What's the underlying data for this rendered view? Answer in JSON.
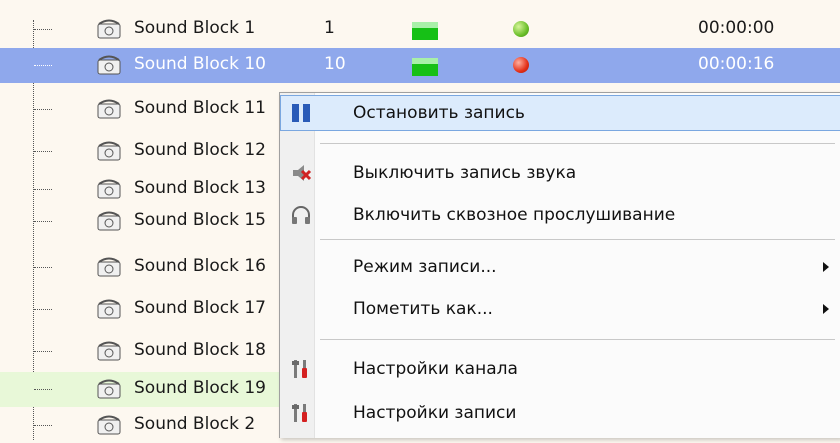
{
  "rows": [
    {
      "name": "Sound Block 1",
      "num": "1",
      "time": "00:00:00",
      "status": "green"
    },
    {
      "name": "Sound Block 10",
      "num": "10",
      "time": "00:00:16",
      "status": "red"
    },
    {
      "name": "Sound Block 11",
      "num": "",
      "time": "",
      "status": ""
    },
    {
      "name": "Sound Block 12",
      "num": "",
      "time": "",
      "status": ""
    },
    {
      "name": "Sound Block 13",
      "num": "",
      "time": "",
      "status": ""
    },
    {
      "name": "Sound Block 15",
      "num": "",
      "time": "",
      "status": ""
    },
    {
      "name": "Sound Block 16",
      "num": "",
      "time": "",
      "status": ""
    },
    {
      "name": "Sound Block 17",
      "num": "",
      "time": "",
      "status": ""
    },
    {
      "name": "Sound Block 18",
      "num": "",
      "time": "",
      "status": ""
    },
    {
      "name": "Sound Block 19",
      "num": "",
      "time": "",
      "status": ""
    },
    {
      "name": "Sound Block 2",
      "num": "",
      "time": "",
      "status": ""
    }
  ],
  "menu": {
    "items": [
      {
        "label": "Остановить запись",
        "icon": "pause-icon",
        "submenu": false
      },
      {
        "label": "Выключить запись звука",
        "icon": "mute-icon",
        "submenu": false
      },
      {
        "label": "Включить сквозное прослушивание",
        "icon": "headphones-icon",
        "submenu": false
      },
      {
        "label": "Режим записи...",
        "icon": "",
        "submenu": true
      },
      {
        "label": "Пометить как...",
        "icon": "",
        "submenu": true
      },
      {
        "label": "Настройки канала",
        "icon": "settings-tools-icon",
        "submenu": false
      },
      {
        "label": "Настройки записи",
        "icon": "settings-tools-icon",
        "submenu": false
      }
    ]
  },
  "colors": {
    "selected_row": "#8fa8ec",
    "highlight_row": "#e8f8d8",
    "level_meter": "#16c016",
    "status_green": "#6bbf2a",
    "status_red": "#e43018"
  }
}
